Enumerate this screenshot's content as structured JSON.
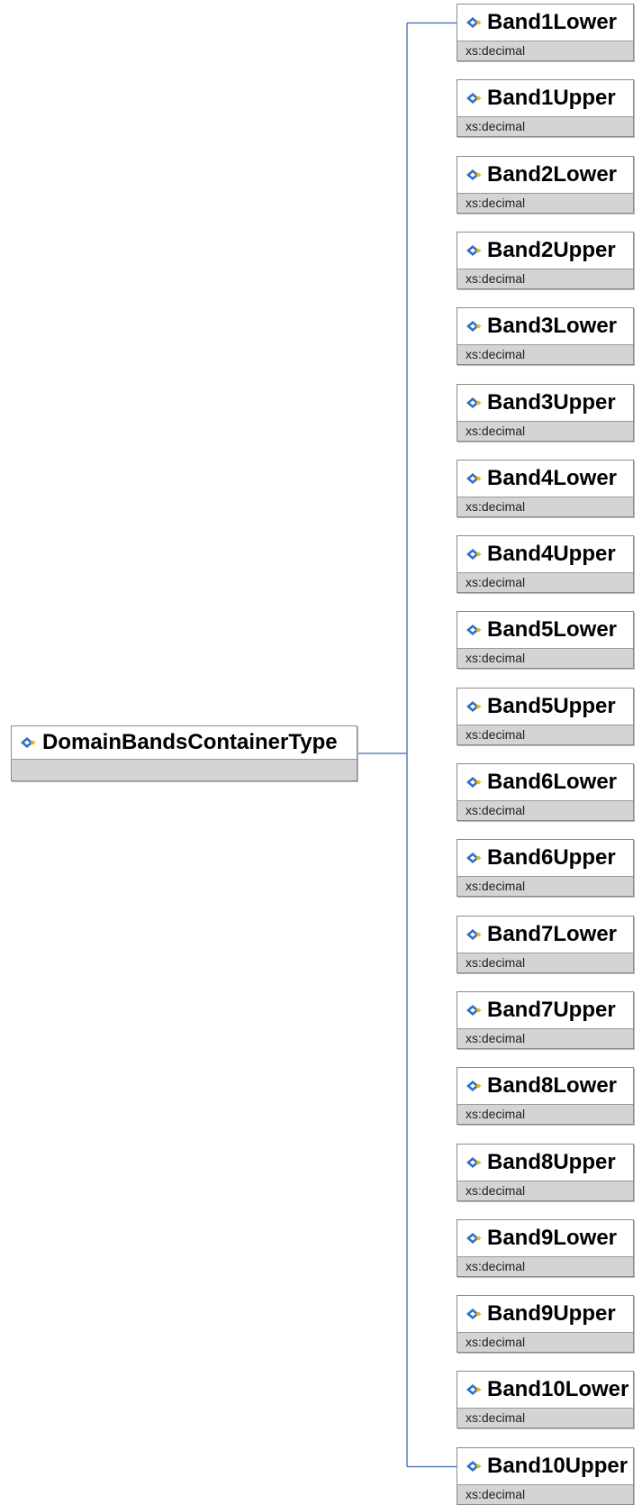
{
  "root": {
    "name": "DomainBandsContainerType"
  },
  "elements": [
    {
      "name": "Band1Lower",
      "type": "xs:decimal"
    },
    {
      "name": "Band1Upper",
      "type": "xs:decimal"
    },
    {
      "name": "Band2Lower",
      "type": "xs:decimal"
    },
    {
      "name": "Band2Upper",
      "type": "xs:decimal"
    },
    {
      "name": "Band3Lower",
      "type": "xs:decimal"
    },
    {
      "name": "Band3Upper",
      "type": "xs:decimal"
    },
    {
      "name": "Band4Lower",
      "type": "xs:decimal"
    },
    {
      "name": "Band4Upper",
      "type": "xs:decimal"
    },
    {
      "name": "Band5Lower",
      "type": "xs:decimal"
    },
    {
      "name": "Band5Upper",
      "type": "xs:decimal"
    },
    {
      "name": "Band6Lower",
      "type": "xs:decimal"
    },
    {
      "name": "Band6Upper",
      "type": "xs:decimal"
    },
    {
      "name": "Band7Lower",
      "type": "xs:decimal"
    },
    {
      "name": "Band7Upper",
      "type": "xs:decimal"
    },
    {
      "name": "Band8Lower",
      "type": "xs:decimal"
    },
    {
      "name": "Band8Upper",
      "type": "xs:decimal"
    },
    {
      "name": "Band9Lower",
      "type": "xs:decimal"
    },
    {
      "name": "Band9Upper",
      "type": "xs:decimal"
    },
    {
      "name": "Band10Lower",
      "type": "xs:decimal"
    },
    {
      "name": "Band10Upper",
      "type": "xs:decimal"
    }
  ],
  "icons": {
    "element": "element-diamond-icon"
  },
  "colors": {
    "connector": "#3c6cb4",
    "icon_blue": "#2f6fc8",
    "icon_gold": "#f0b400",
    "node_fill": "#d4d4d4",
    "node_header": "#ffffff"
  }
}
